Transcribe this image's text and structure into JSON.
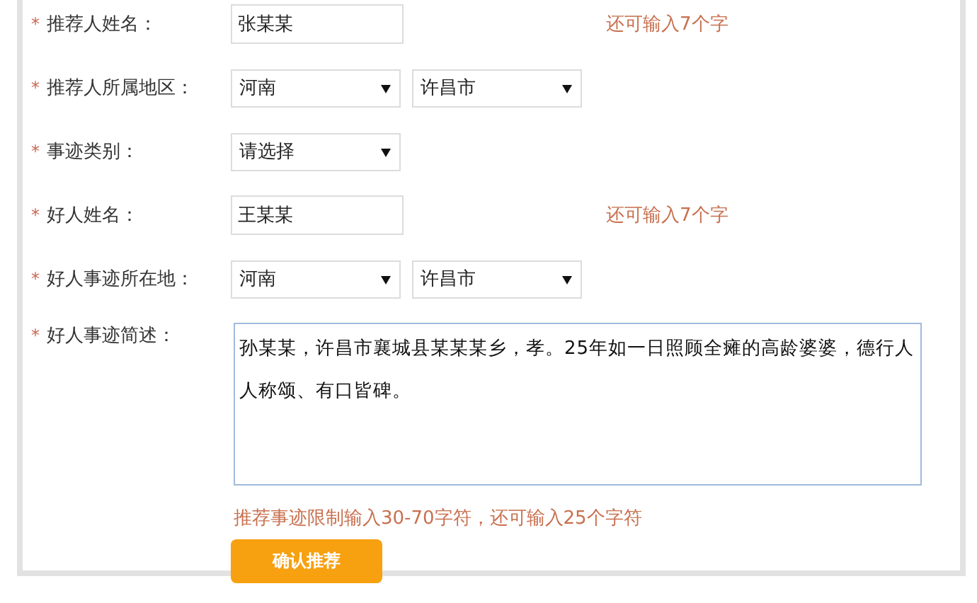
{
  "form": {
    "fields": [
      {
        "kind": "text",
        "mark": "*",
        "label": "推荐人姓名：",
        "value": "张某某",
        "hint": "还可输入7个字"
      },
      {
        "kind": "select",
        "mark": "*",
        "label": "推荐人所属地区：",
        "selects": [
          {
            "value": "河南"
          },
          {
            "value": "许昌市"
          }
        ]
      },
      {
        "kind": "select",
        "mark": "*",
        "label": "事迹类别：",
        "selects": [
          {
            "value": "请选择"
          }
        ]
      },
      {
        "kind": "text",
        "mark": "*",
        "label": "好人姓名：",
        "value": "王某某",
        "hint": "还可输入7个字"
      },
      {
        "kind": "select",
        "mark": "*",
        "label": "好人事迹所在地：",
        "selects": [
          {
            "value": "河南"
          },
          {
            "value": "许昌市"
          }
        ]
      },
      {
        "kind": "textarea",
        "mark": "*",
        "label": "好人事迹简述：",
        "value": "孙某某，许昌市襄城县某某某乡，孝。25年如一日照顾全瘫的高龄婆婆，德行人人称颂、有口皆碑。",
        "hint": "推荐事迹限制输入30-70字符，还可输入25个字符"
      }
    ],
    "submit": "确认推荐"
  }
}
